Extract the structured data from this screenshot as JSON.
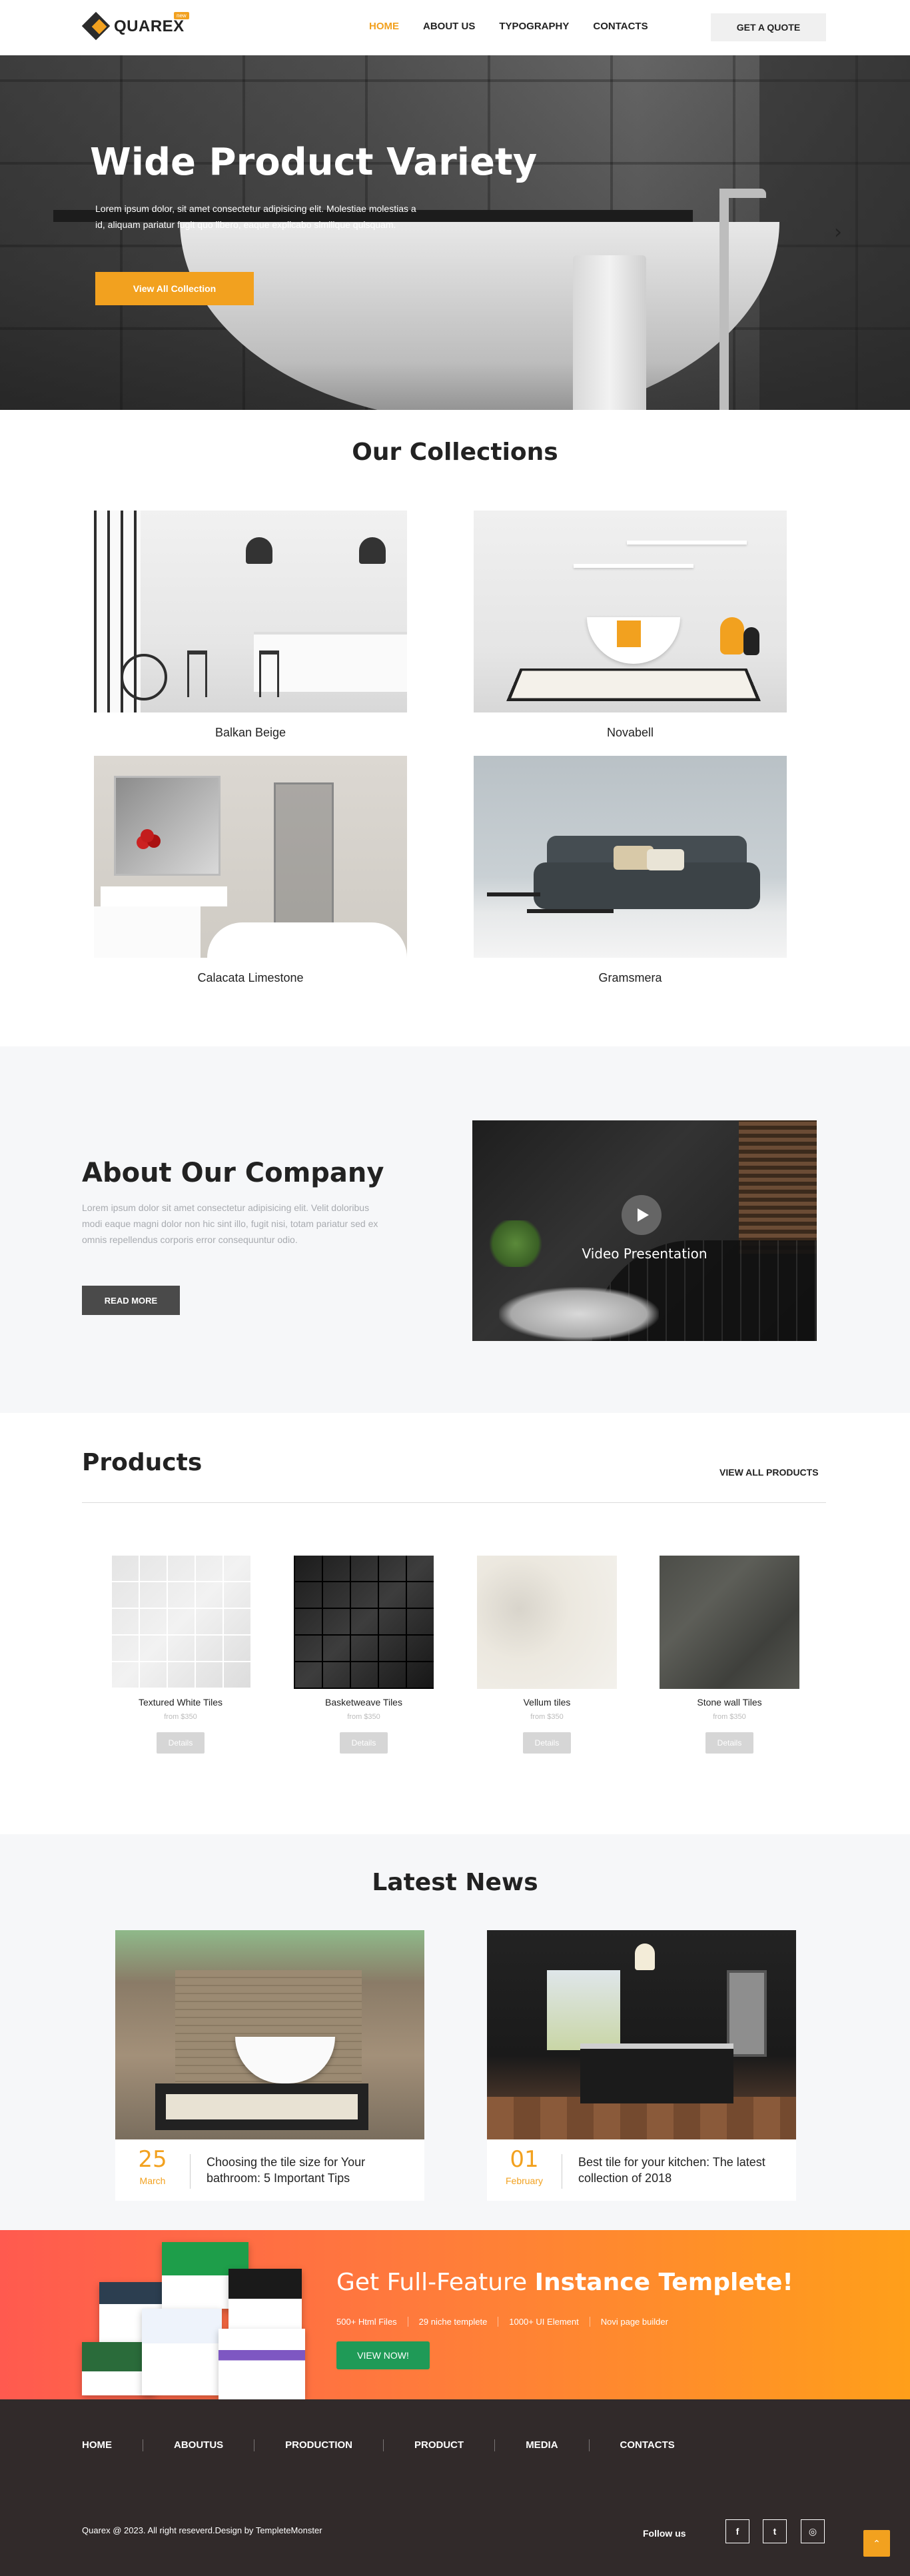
{
  "header": {
    "logo_text": "QUAREX",
    "logo_badge": "new",
    "nav": [
      {
        "label": "HOME",
        "active": true
      },
      {
        "label": "ABOUT US",
        "active": false
      },
      {
        "label": "TYPOGRAPHY",
        "active": false
      },
      {
        "label": "CONTACTS",
        "active": false
      }
    ],
    "quote_label": "GET A QUOTE"
  },
  "hero": {
    "title": "Wide Product Variety",
    "text": "Lorem ipsum dolor, sit amet consectetur adipisicing elit. Molestiae molestias a id, aliquam pariatur fugit quo libero, eaque explicabo similique quisquam.",
    "cta_label": "View All Collection",
    "next_arrow": "›"
  },
  "collections": {
    "title": "Our Collections",
    "items": [
      {
        "name": "Balkan Beige",
        "image": "kitchen"
      },
      {
        "name": "Novabell",
        "image": "bathroom-bathtub"
      },
      {
        "name": "Calacata Limestone",
        "image": "bathroom-shower"
      },
      {
        "name": "Gramsmera",
        "image": "living-room-sofa"
      }
    ]
  },
  "about": {
    "title": "About Our Company",
    "text": "Lorem ipsum dolor sit amet consectetur adipisicing elit. Velit doloribus modi eaque magni dolor non hic sint illo, fugit nisi, totam pariatur sed ex omnis repellendus corporis error consequuntur odio.",
    "button_label": "READ MORE",
    "video_label": "Video Presentation"
  },
  "products": {
    "title": "Products",
    "view_all_label": "VIEW ALL PRODUCTS",
    "items": [
      {
        "name": "Textured White Tiles",
        "price": "from $350",
        "details_label": "Details"
      },
      {
        "name": "Basketweave Tiles",
        "price": "from $350",
        "details_label": "Details"
      },
      {
        "name": "Vellum tiles",
        "price": "from $350",
        "details_label": "Details"
      },
      {
        "name": "Stone wall Tiles",
        "price": "from $350",
        "details_label": "Details"
      }
    ]
  },
  "news": {
    "title": "Latest News",
    "items": [
      {
        "day": "25",
        "month": "March",
        "headline": "Choosing the tile size for Your bathroom: 5 Important Tips"
      },
      {
        "day": "01",
        "month": "February",
        "headline": "Best tile for your kitchen: The latest collection of 2018"
      }
    ]
  },
  "promo": {
    "title_light": "Get Full-Feature ",
    "title_bold": "Instance Templete!",
    "features": [
      "500+ Html Files",
      "29 niche templete",
      "1000+ UI Element",
      "Novi page builder"
    ],
    "button_label": "VIEW NOW!"
  },
  "footer": {
    "nav": [
      "HOME",
      "ABOUTUS",
      "PRODUCTION",
      "PRODUCT",
      "MEDIA",
      "CONTACTS"
    ],
    "copyright": "Quarex @ 2023. All right reseverd.Design by TempleteMonster",
    "follow_label": "Follow us",
    "social": [
      {
        "name": "facebook",
        "glyph": "f"
      },
      {
        "name": "twitter",
        "glyph": "t"
      },
      {
        "name": "instagram",
        "glyph": "◎"
      }
    ],
    "scroll_top_glyph": "⌃"
  },
  "colors": {
    "accent": "#f2a11f",
    "dark": "#312a2a",
    "promo_start": "#ff5a4f",
    "promo_end": "#ff9f1a",
    "promo_button": "#1f9a57"
  }
}
